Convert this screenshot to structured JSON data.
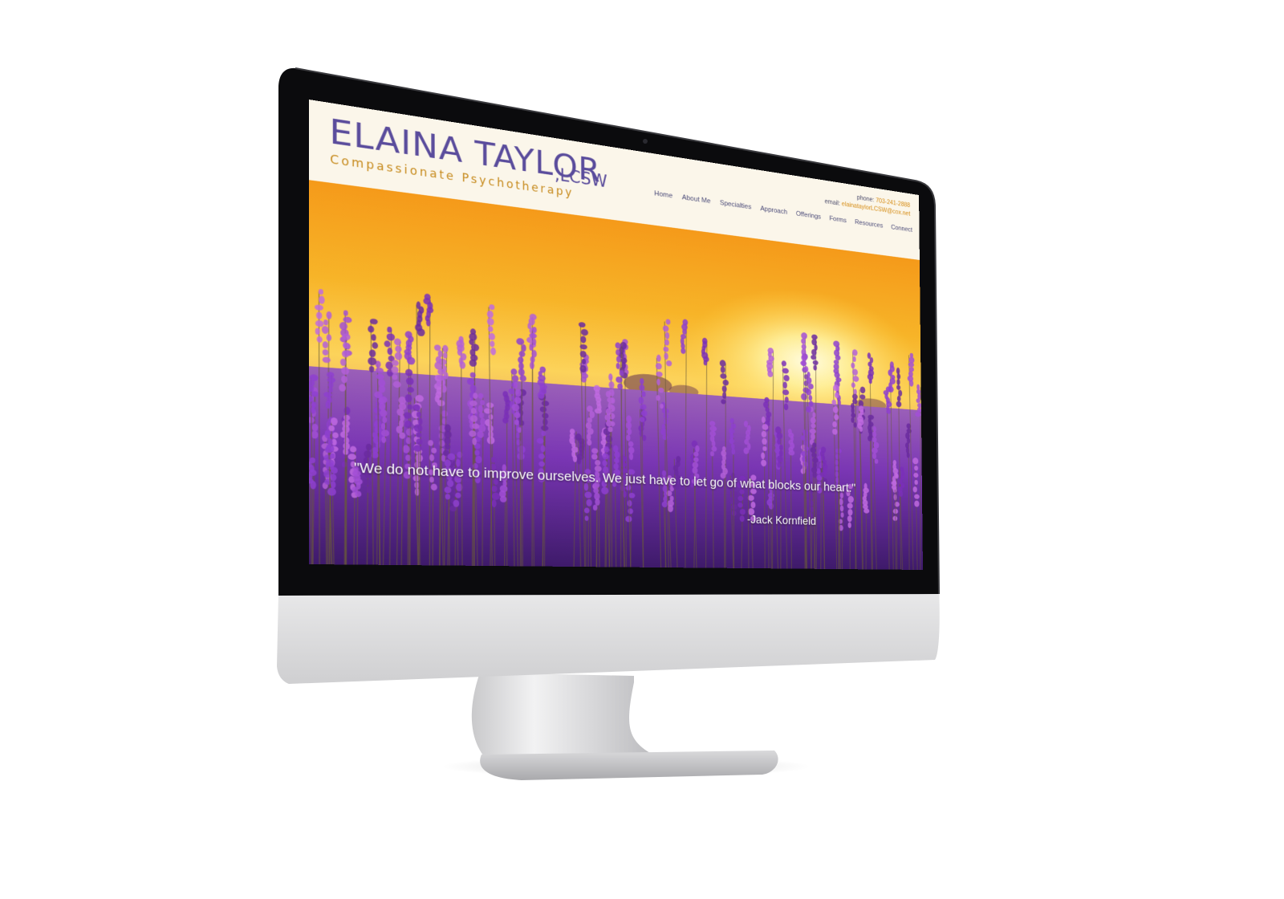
{
  "site": {
    "brand_name": "ELAINA TAYLOR",
    "brand_credential": ",LCSW",
    "tagline": "Compassionate Psychotherapy",
    "contact": {
      "phone_label": "phone:",
      "phone_value": "703-241-2888",
      "email_label": "email:",
      "email_value": "elainataylorLCSW@cox.net"
    },
    "nav": [
      "Home",
      "About Me",
      "Specialties",
      "Approach",
      "Offerings",
      "Forms",
      "Resources",
      "Connect"
    ]
  },
  "hero": {
    "quote": "\"We do not have to improve ourselves. We just have to let go of what blocks our heart.\"",
    "author": "-Jack Kornfield"
  },
  "colors": {
    "brand_purple": "#5a4c9c",
    "accent_gold": "#c68a1c",
    "header_bg": "#fbf6ea",
    "lavender": "#8a3fc4",
    "sunset": "#ffbf33"
  }
}
